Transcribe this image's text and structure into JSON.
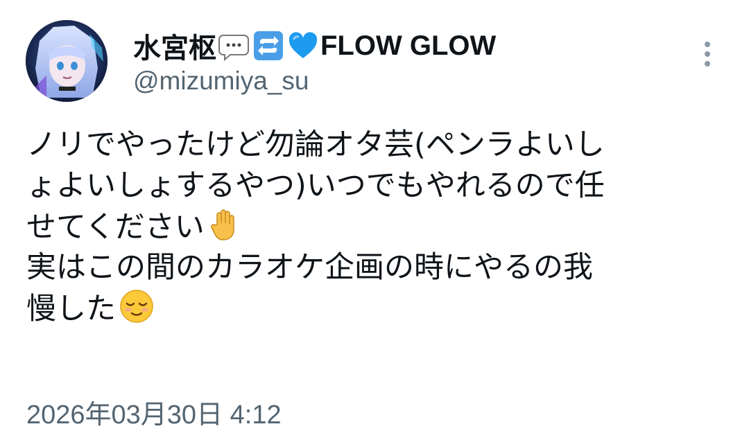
{
  "author": {
    "display_name_prefix": "水宮枢",
    "display_name_suffix": "FLOW GLOW",
    "name_emojis": [
      "speech-bubble-icon",
      "repeat-arrows-icon",
      "blue-heart-icon"
    ],
    "handle": "@mizumiya_su"
  },
  "tweet": {
    "lines": [
      "ノリでやったけど勿論オタ芸(ペンラよいし",
      "ょよいしょするやつ)いつでもやれるので任",
      "せてください",
      "実はこの間のカラオケ企画の時にやるの我",
      "慢した"
    ],
    "emojis": {
      "line3": "raised-hand-icon",
      "line5": "relieved-face-icon"
    }
  },
  "timestamp": "2026年03月30日 4:12",
  "colors": {
    "text": "#0f1419",
    "secondary": "#536471",
    "blue_heart": "#1d9bf0",
    "repeat_bg": "#4a9ee8"
  }
}
